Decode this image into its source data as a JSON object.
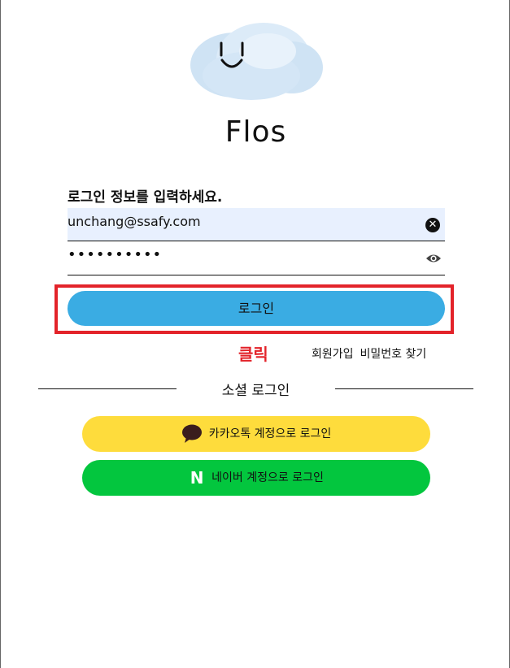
{
  "app": {
    "title": "Flos"
  },
  "login": {
    "prompt": "로그인 정보를 입력하세요.",
    "email_value": "unchang@ssafy.com",
    "password_masked": "••••••••••",
    "clear_glyph": "✕",
    "submit_label": "로그인"
  },
  "annotation": {
    "click_label": "클릭",
    "highlight_color": "#e3232a"
  },
  "links": {
    "signup": "회원가입",
    "find_password": "비밀번호 찾기"
  },
  "social": {
    "title": "소셜 로그인",
    "kakao_label": "카카오톡 계정으로 로그인",
    "naver_label": "네이버 계정으로 로그인",
    "naver_glyph": "N",
    "kakao_color": "#fedc3c",
    "naver_color": "#03c63e"
  },
  "colors": {
    "primary": "#3aace3",
    "input_bg": "#e8f0fe"
  },
  "icons": [
    "cloud-logo-icon",
    "clear-icon",
    "eye-icon",
    "kakao-chat-icon",
    "naver-icon"
  ]
}
